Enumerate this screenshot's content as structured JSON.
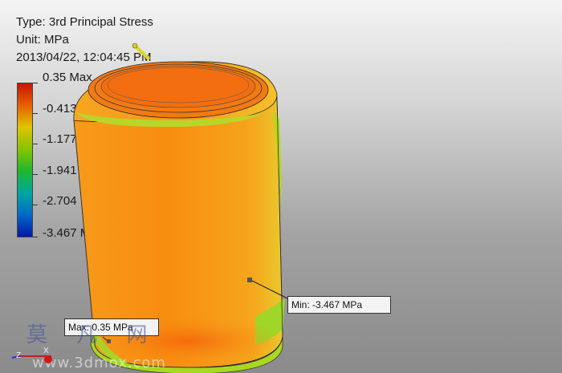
{
  "result_info": {
    "type_line": "Type: 3rd Principal Stress",
    "unit_line": "Unit: MPa",
    "timestamp": "2013/04/22, 12:04:45 PM"
  },
  "legend": {
    "labels": [
      "0.35 Max",
      "-0.413",
      "-1.177",
      "-1.941",
      "-2.704",
      "-3.467 Min"
    ],
    "colors": [
      "#c81400",
      "#e66000",
      "#e0c400",
      "#86c400",
      "#1fb82e",
      "#00a6a0",
      "#0068c8",
      "#0018a8"
    ]
  },
  "probes": {
    "min_label": "Min: -3.467 MPa",
    "max_label": "Max: 0.35 MPa"
  },
  "triad": {
    "x": "X",
    "z": "Z"
  },
  "watermark": {
    "chars": "莫 凡 网",
    "url": "www.3dmox.com"
  }
}
